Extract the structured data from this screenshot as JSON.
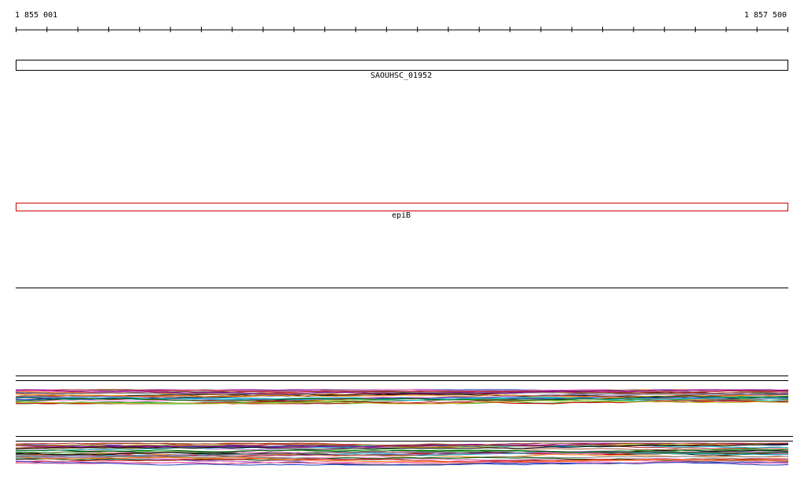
{
  "ruler": {
    "start_label": "1 855 001",
    "end_label": "1 857 500",
    "tick_count": 26
  },
  "tracks": [
    {
      "name": "SAOUHSC_01952",
      "color": "#000000"
    },
    {
      "name": "epiB",
      "color": "#cc0000"
    }
  ],
  "profile_colors": [
    "#000000",
    "#1f3fbf",
    "#cc0000",
    "#2ca02c",
    "#9467bd",
    "#8c564b",
    "#bcbd22",
    "#e377c2",
    "#ff7f0e",
    "#17becf",
    "#7f7f7f",
    "#b22222",
    "#006400",
    "#8b008b",
    "#a0522d",
    "#ff69b4"
  ]
}
